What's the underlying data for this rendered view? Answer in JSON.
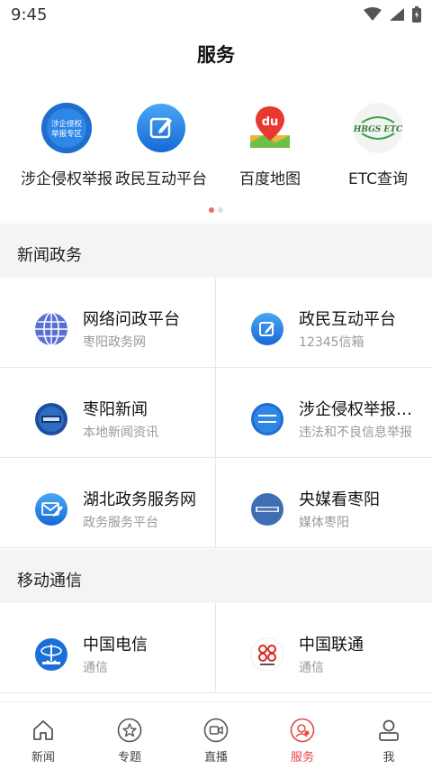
{
  "status": {
    "time": "9:45"
  },
  "header": {
    "title": "服务"
  },
  "quick_links": [
    {
      "label": "涉企侵权举报",
      "icon": "report-badge-icon",
      "badge_text": "涉企侵权\n举报专区"
    },
    {
      "label": "政民互动平台",
      "icon": "edit-icon"
    },
    {
      "label": "百度地图",
      "icon": "baidu-map-icon",
      "badge_text": "du"
    },
    {
      "label": "ETC查询",
      "icon": "etc-logo-icon",
      "badge_text": "HBGS ETC"
    }
  ],
  "sections": {
    "news_gov": {
      "title": "新闻政务",
      "items": [
        {
          "title": "网络问政平台",
          "subtitle": "枣阳政务网",
          "icon": "globe-icon"
        },
        {
          "title": "政民互动平台",
          "subtitle": "12345信箱",
          "icon": "edit-icon"
        },
        {
          "title": "枣阳新闻",
          "subtitle": "本地新闻资讯",
          "icon": "news-logo-icon"
        },
        {
          "title": "涉企侵权举报专区",
          "subtitle": "违法和不良信息举报",
          "icon": "report-badge-icon"
        },
        {
          "title": "湖北政务服务网",
          "subtitle": "政务服务平台",
          "icon": "mail-edit-icon"
        },
        {
          "title": "央媒看枣阳",
          "subtitle": "媒体枣阳",
          "icon": "media-logo-icon"
        }
      ]
    },
    "telecom": {
      "title": "移动通信",
      "items": [
        {
          "title": "中国电信",
          "subtitle": "通信",
          "icon": "china-telecom-icon"
        },
        {
          "title": "中国联通",
          "subtitle": "通信",
          "icon": "china-unicom-icon"
        }
      ]
    }
  },
  "tabbar": [
    {
      "label": "新闻",
      "icon": "home-icon"
    },
    {
      "label": "专题",
      "icon": "star-icon"
    },
    {
      "label": "直播",
      "icon": "video-icon"
    },
    {
      "label": "服务",
      "icon": "service-icon",
      "active": true
    },
    {
      "label": "我",
      "icon": "user-icon"
    }
  ],
  "colors": {
    "accent": "#e64545",
    "icon_blue": "#1e7fe0",
    "section_bg": "#f3f4f6"
  }
}
